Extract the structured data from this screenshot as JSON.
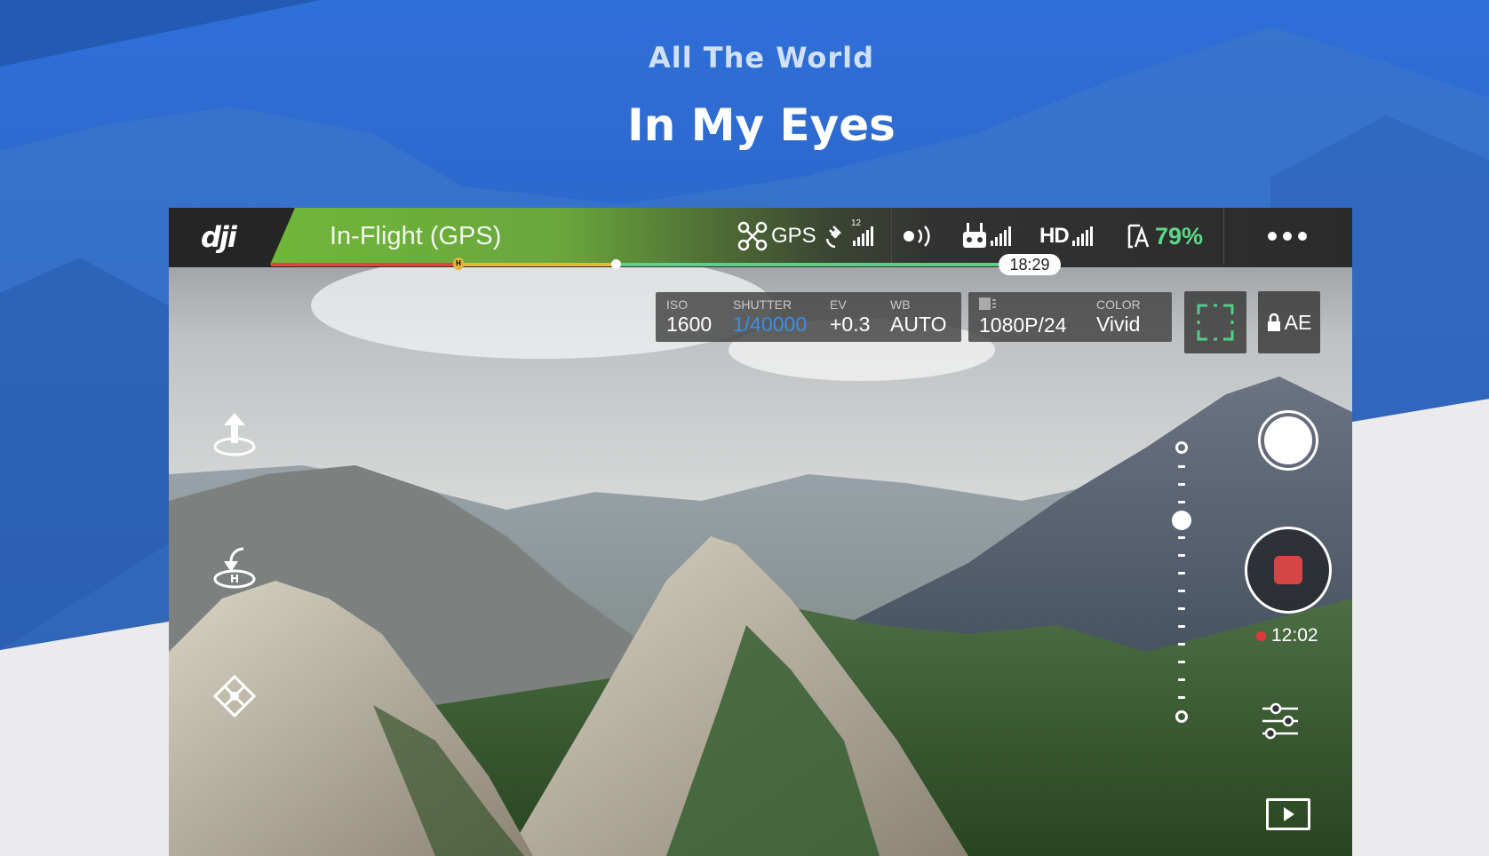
{
  "hero": {
    "line1": "All The World",
    "line2": "In My Eyes"
  },
  "colors": {
    "accent_green": "#6fb73a",
    "battery_green": "#5fd68a",
    "shutter_blue": "#3a8ee6",
    "record_red": "#d64545",
    "brand_blue": "#2f6fd1"
  },
  "topbar": {
    "logo": "dji",
    "flight_mode": "In-Flight (GPS)",
    "gps_label": "GPS",
    "satellite_count": "12",
    "hd_label": "HD",
    "battery": "79%",
    "flight_time_remaining": "18:29",
    "home_marker": "H",
    "more_icon": "more-dots-icon"
  },
  "camera": {
    "params": [
      {
        "label": "ISO",
        "value": "1600"
      },
      {
        "label": "SHUTTER",
        "value": "1/40000"
      },
      {
        "label": "EV",
        "value": "+0.3"
      },
      {
        "label": "WB",
        "value": "AUTO"
      }
    ],
    "storage_icon": "sd-card-icon",
    "resolution": "1080P/24",
    "color_label": "COLOR",
    "color_value": "Vivid",
    "ae_label": "AE"
  },
  "left_tools": [
    "takeoff-icon",
    "return-home-icon",
    "drone-icon"
  ],
  "right_tools": {
    "record_time": "12:02",
    "gimbal_slider_level": 0.27
  }
}
